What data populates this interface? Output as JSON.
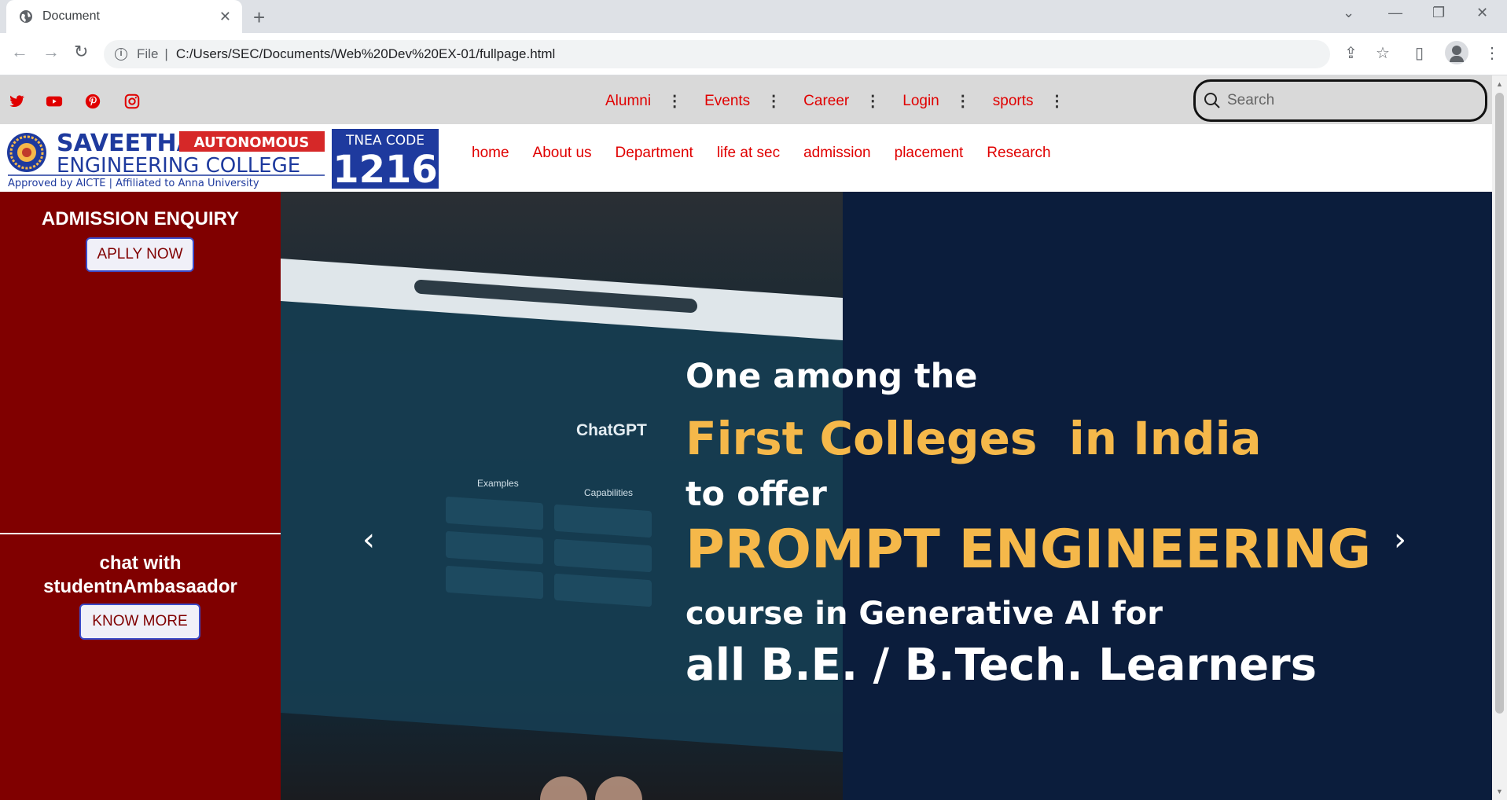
{
  "browser": {
    "tab_title": "Document",
    "url_prefix": "File",
    "url": "C:/Users/SEC/Documents/Web%20Dev%20EX-01/fullpage.html"
  },
  "topbar": {
    "social": [
      "twitter-icon",
      "youtube-icon",
      "pinterest-icon",
      "instagram-icon"
    ],
    "nav": [
      "Alumni",
      "Events",
      "Career",
      "Login",
      "sports"
    ],
    "search_placeholder": "Search"
  },
  "logo": {
    "name_line1": "SAVEETHA",
    "name_line2": "ENGINEERING COLLEGE",
    "badge": "AUTONOMOUS",
    "tagline": "Approved by AICTE  |  Affiliated to Anna University",
    "tnea_label": "TNEA CODE",
    "tnea_code": "1216"
  },
  "mainnav": [
    "home",
    "About us",
    "Department",
    "life at sec",
    "admission",
    "placement",
    "Research"
  ],
  "sidebar": {
    "panel1_title": "ADMISSION ENQUIRY",
    "panel1_button": "APLLY NOW",
    "panel2_title_line1": "chat with",
    "panel2_title_line2": "studentnAmbasaador",
    "panel2_button": "KNOW MORE"
  },
  "hero": {
    "screen_title": "ChatGPT",
    "screen_cols": [
      "Examples",
      "Capabilities"
    ],
    "line1": "One among the",
    "line2a": "First Colleges",
    "line2b": "in India",
    "line3": "to offer",
    "line4": "PROMPT ENGINEERING",
    "line5": "course in Generative AI for",
    "line6": "all B.E. / B.Tech. Learners"
  },
  "colors": {
    "accent_red": "#e00000",
    "sidebar_maroon": "#800000",
    "hero_navy": "#0b1d3c",
    "hero_gold": "#f5b84a",
    "logo_blue": "#1e3a9e"
  }
}
